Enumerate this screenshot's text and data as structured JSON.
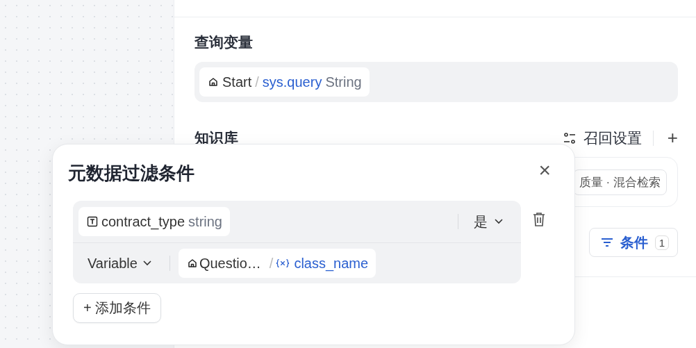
{
  "query_section": {
    "title": "查询变量",
    "variable": {
      "node": "Start",
      "separator": "/",
      "name": "sys.query",
      "type": "String"
    }
  },
  "knowledge_section": {
    "title": "知识库",
    "recall_settings": "召回设置",
    "add": "+",
    "dataset_tag": "质量 · 混合检索",
    "conditions_button": {
      "label": "条件",
      "count": "1"
    }
  },
  "filter_popup": {
    "title": "元数据过滤条件",
    "close": "×",
    "conditions": [
      {
        "field": "contract_type",
        "field_type": "string",
        "operator": "是",
        "value_mode": "Variable",
        "value_node": "Questio…",
        "separator": "/",
        "value_name": "class_name"
      }
    ],
    "add_button": "+ 添加条件"
  }
}
